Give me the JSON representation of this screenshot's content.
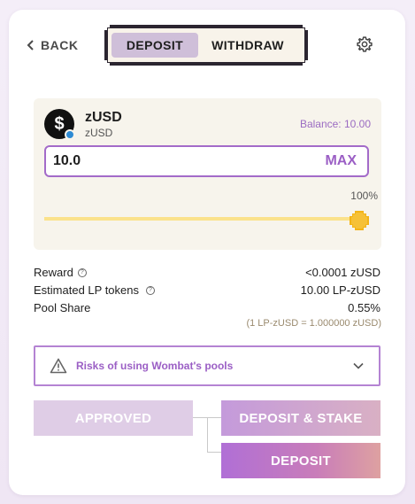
{
  "header": {
    "back_label": "BACK",
    "tabs": [
      {
        "label": "DEPOSIT",
        "active": true
      },
      {
        "label": "WITHDRAW",
        "active": false
      }
    ]
  },
  "token": {
    "symbol": "zUSD",
    "name": "zUSD",
    "balance_text": "Balance: 10.00",
    "icon_glyph": "$",
    "amount_value": "10.0",
    "max_label": "MAX",
    "percent_text": "100%",
    "slider_fraction": 1.0
  },
  "info": {
    "reward_label": "Reward",
    "reward_value": "<0.0001 zUSD",
    "lp_label": "Estimated LP tokens",
    "lp_value": "10.00 LP-zUSD",
    "share_label": "Pool Share",
    "share_value": "0.55%",
    "rate_text": "(1 LP-zUSD = 1.000000 zUSD)",
    "help_glyph": "?"
  },
  "risk": {
    "label": "Risks of using Wombat's pools"
  },
  "actions": {
    "approved_label": "APPROVED",
    "stake_label": "DEPOSIT & STAKE",
    "deposit_label": "DEPOSIT"
  },
  "colors": {
    "accent": "#9b5fc5",
    "slider_fill": "#fbe28b",
    "slider_thumb": "#f3b418",
    "panel_bg": "#f7f4ec"
  },
  "icons": {
    "back": "chevron-left-icon",
    "settings": "gear-icon",
    "warning": "warning-triangle-icon",
    "expand": "chevron-down-icon",
    "token": "dollar-coin-icon",
    "help": "question-circle-icon"
  }
}
